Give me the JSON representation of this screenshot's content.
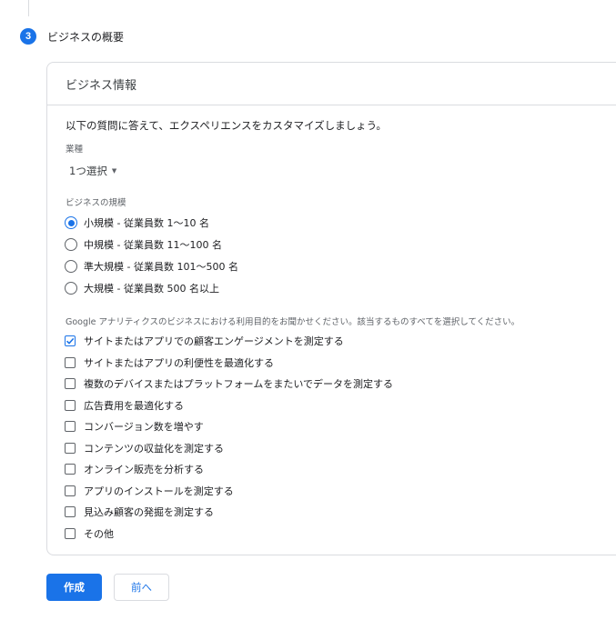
{
  "step": {
    "number": "3",
    "title": "ビジネスの概要"
  },
  "card": {
    "title": "ビジネス情報",
    "intro": "以下の質問に答えて、エクスペリエンスをカスタマイズしましょう。",
    "industry": {
      "label": "業種",
      "selected": "1つ選択"
    },
    "size": {
      "label": "ビジネスの規模",
      "options": [
        {
          "label": "小規模 - 従業員数 1～10 名",
          "checked": true
        },
        {
          "label": "中規模 - 従業員数 11～100 名",
          "checked": false
        },
        {
          "label": "準大規模 - 従業員数 101～500 名",
          "checked": false
        },
        {
          "label": "大規模 - 従業員数 500 名以上",
          "checked": false
        }
      ]
    },
    "usage": {
      "label": "Google アナリティクスのビジネスにおける利用目的をお聞かせください。該当するものすべてを選択してください。",
      "options": [
        {
          "label": "サイトまたはアプリでの顧客エンゲージメントを測定する",
          "checked": true
        },
        {
          "label": "サイトまたはアプリの利便性を最適化する",
          "checked": false
        },
        {
          "label": "複数のデバイスまたはプラットフォームをまたいでデータを測定する",
          "checked": false
        },
        {
          "label": "広告費用を最適化する",
          "checked": false
        },
        {
          "label": "コンバージョン数を増やす",
          "checked": false
        },
        {
          "label": "コンテンツの収益化を測定する",
          "checked": false
        },
        {
          "label": "オンライン販売を分析する",
          "checked": false
        },
        {
          "label": "アプリのインストールを測定する",
          "checked": false
        },
        {
          "label": "見込み顧客の発掘を測定する",
          "checked": false
        },
        {
          "label": "その他",
          "checked": false
        }
      ]
    }
  },
  "actions": {
    "create_label": "作成",
    "back_label": "前へ"
  },
  "colors": {
    "accent": "#1a73e8",
    "border": "#dadce0",
    "text": "#202124",
    "muted": "#5f6368"
  }
}
